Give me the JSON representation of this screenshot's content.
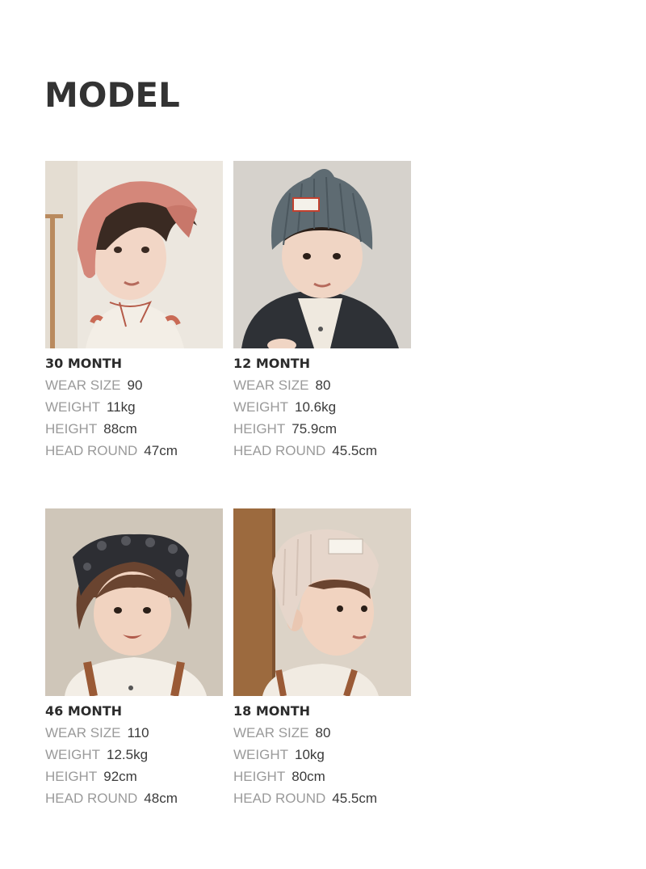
{
  "title": "MODEL",
  "labels": {
    "wear_size": "WEAR SIZE",
    "weight": "WEIGHT",
    "height": "HEIGHT",
    "head_round": "HEAD ROUND"
  },
  "models": [
    {
      "age": "30 MONTH",
      "wear_size": "90",
      "weight": "11kg",
      "height": "88cm",
      "head_round": "47cm"
    },
    {
      "age": "12 MONTH",
      "wear_size": "80",
      "weight": "10.6kg",
      "height": "75.9cm",
      "head_round": "45.5cm"
    },
    {
      "age": "46 MONTH",
      "wear_size": "110",
      "weight": "12.5kg",
      "height": "92cm",
      "head_round": "48cm"
    },
    {
      "age": "18 MONTH",
      "wear_size": "80",
      "weight": "10kg",
      "height": "80cm",
      "head_round": "45.5cm"
    }
  ]
}
